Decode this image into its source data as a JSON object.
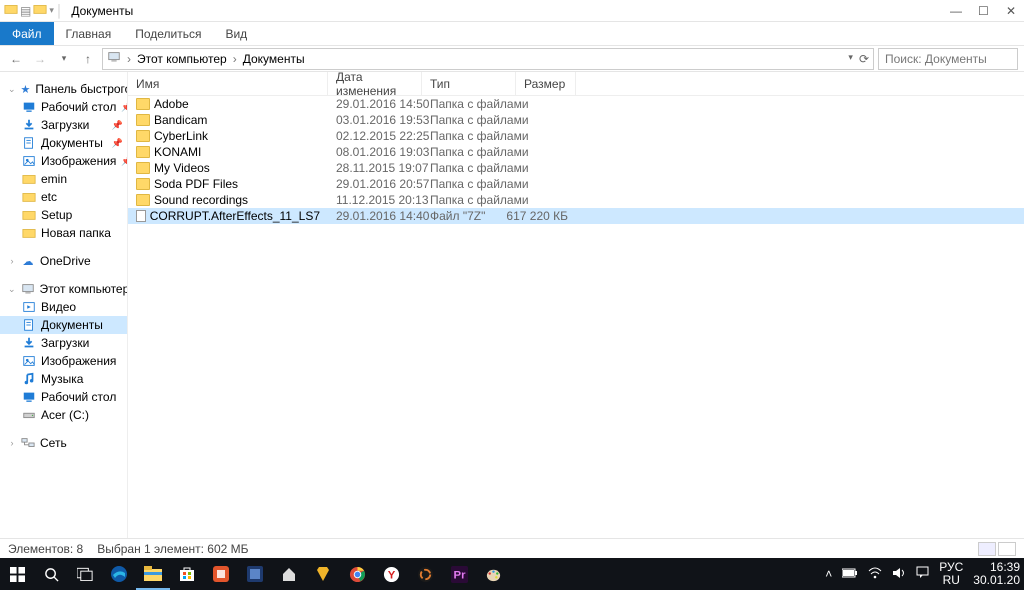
{
  "window": {
    "title": "Документы"
  },
  "ribbon": {
    "file": "Файл",
    "home": "Главная",
    "share": "Поделиться",
    "view": "Вид"
  },
  "address": {
    "crumbs": [
      "Этот компьютер",
      "Документы"
    ],
    "search_placeholder": "Поиск: Документы"
  },
  "tree": {
    "quick_access": "Панель быстрого до",
    "quick_items": [
      {
        "label": "Рабочий стол",
        "icon": "desktop",
        "color": "#1f7cd6",
        "pin": true
      },
      {
        "label": "Загрузки",
        "icon": "download",
        "color": "#1f7cd6",
        "pin": true
      },
      {
        "label": "Документы",
        "icon": "doc",
        "color": "#1f7cd6",
        "pin": true
      },
      {
        "label": "Изображения",
        "icon": "pic",
        "color": "#1f7cd6",
        "pin": true
      },
      {
        "label": "emin",
        "icon": "folder",
        "color": "#ffcf4b"
      },
      {
        "label": "etc",
        "icon": "folder",
        "color": "#ffcf4b"
      },
      {
        "label": "Setup",
        "icon": "folder",
        "color": "#ffcf4b"
      },
      {
        "label": "Новая папка",
        "icon": "folder",
        "color": "#ffcf4b"
      }
    ],
    "onedrive": "OneDrive",
    "this_pc": "Этот компьютер",
    "pc_items": [
      {
        "label": "Видео",
        "icon": "video",
        "sel": false
      },
      {
        "label": "Документы",
        "icon": "doc",
        "sel": true
      },
      {
        "label": "Загрузки",
        "icon": "download",
        "sel": false
      },
      {
        "label": "Изображения",
        "icon": "pic",
        "sel": false
      },
      {
        "label": "Музыка",
        "icon": "music",
        "sel": false
      },
      {
        "label": "Рабочий стол",
        "icon": "desktop",
        "sel": false
      },
      {
        "label": "Acer (C:)",
        "icon": "drive",
        "sel": false
      }
    ],
    "network": "Сеть"
  },
  "columns": {
    "name": "Имя",
    "date": "Дата изменения",
    "type": "Тип",
    "size": "Размер"
  },
  "files": [
    {
      "name": "Adobe",
      "date": "29.01.2016 14:50",
      "type": "Папка с файлами",
      "size": "",
      "kind": "folder",
      "sel": false
    },
    {
      "name": "Bandicam",
      "date": "03.01.2016 19:53",
      "type": "Папка с файлами",
      "size": "",
      "kind": "folder",
      "sel": false
    },
    {
      "name": "CyberLink",
      "date": "02.12.2015 22:25",
      "type": "Папка с файлами",
      "size": "",
      "kind": "folder",
      "sel": false
    },
    {
      "name": "KONAMI",
      "date": "08.01.2016 19:03",
      "type": "Папка с файлами",
      "size": "",
      "kind": "folder",
      "sel": false
    },
    {
      "name": "My Videos",
      "date": "28.11.2015 19:07",
      "type": "Папка с файлами",
      "size": "",
      "kind": "folder",
      "sel": false
    },
    {
      "name": "Soda PDF Files",
      "date": "29.01.2016 20:57",
      "type": "Папка с файлами",
      "size": "",
      "kind": "folder",
      "sel": false
    },
    {
      "name": "Sound recordings",
      "date": "11.12.2015 20:13",
      "type": "Папка с файлами",
      "size": "",
      "kind": "folder",
      "sel": false
    },
    {
      "name": "CORRUPT.AfterEffects_11_LS7",
      "date": "29.01.2016 14:40",
      "type": "Файл \"7Z\"",
      "size": "617 220 КБ",
      "kind": "file",
      "sel": true
    }
  ],
  "status": {
    "count": "Элементов: 8",
    "selection": "Выбран 1 элемент: 602 МБ"
  },
  "taskbar": {
    "lang1": "РУС",
    "lang2": "RU",
    "time": "16:39",
    "date": "30.01.20"
  }
}
